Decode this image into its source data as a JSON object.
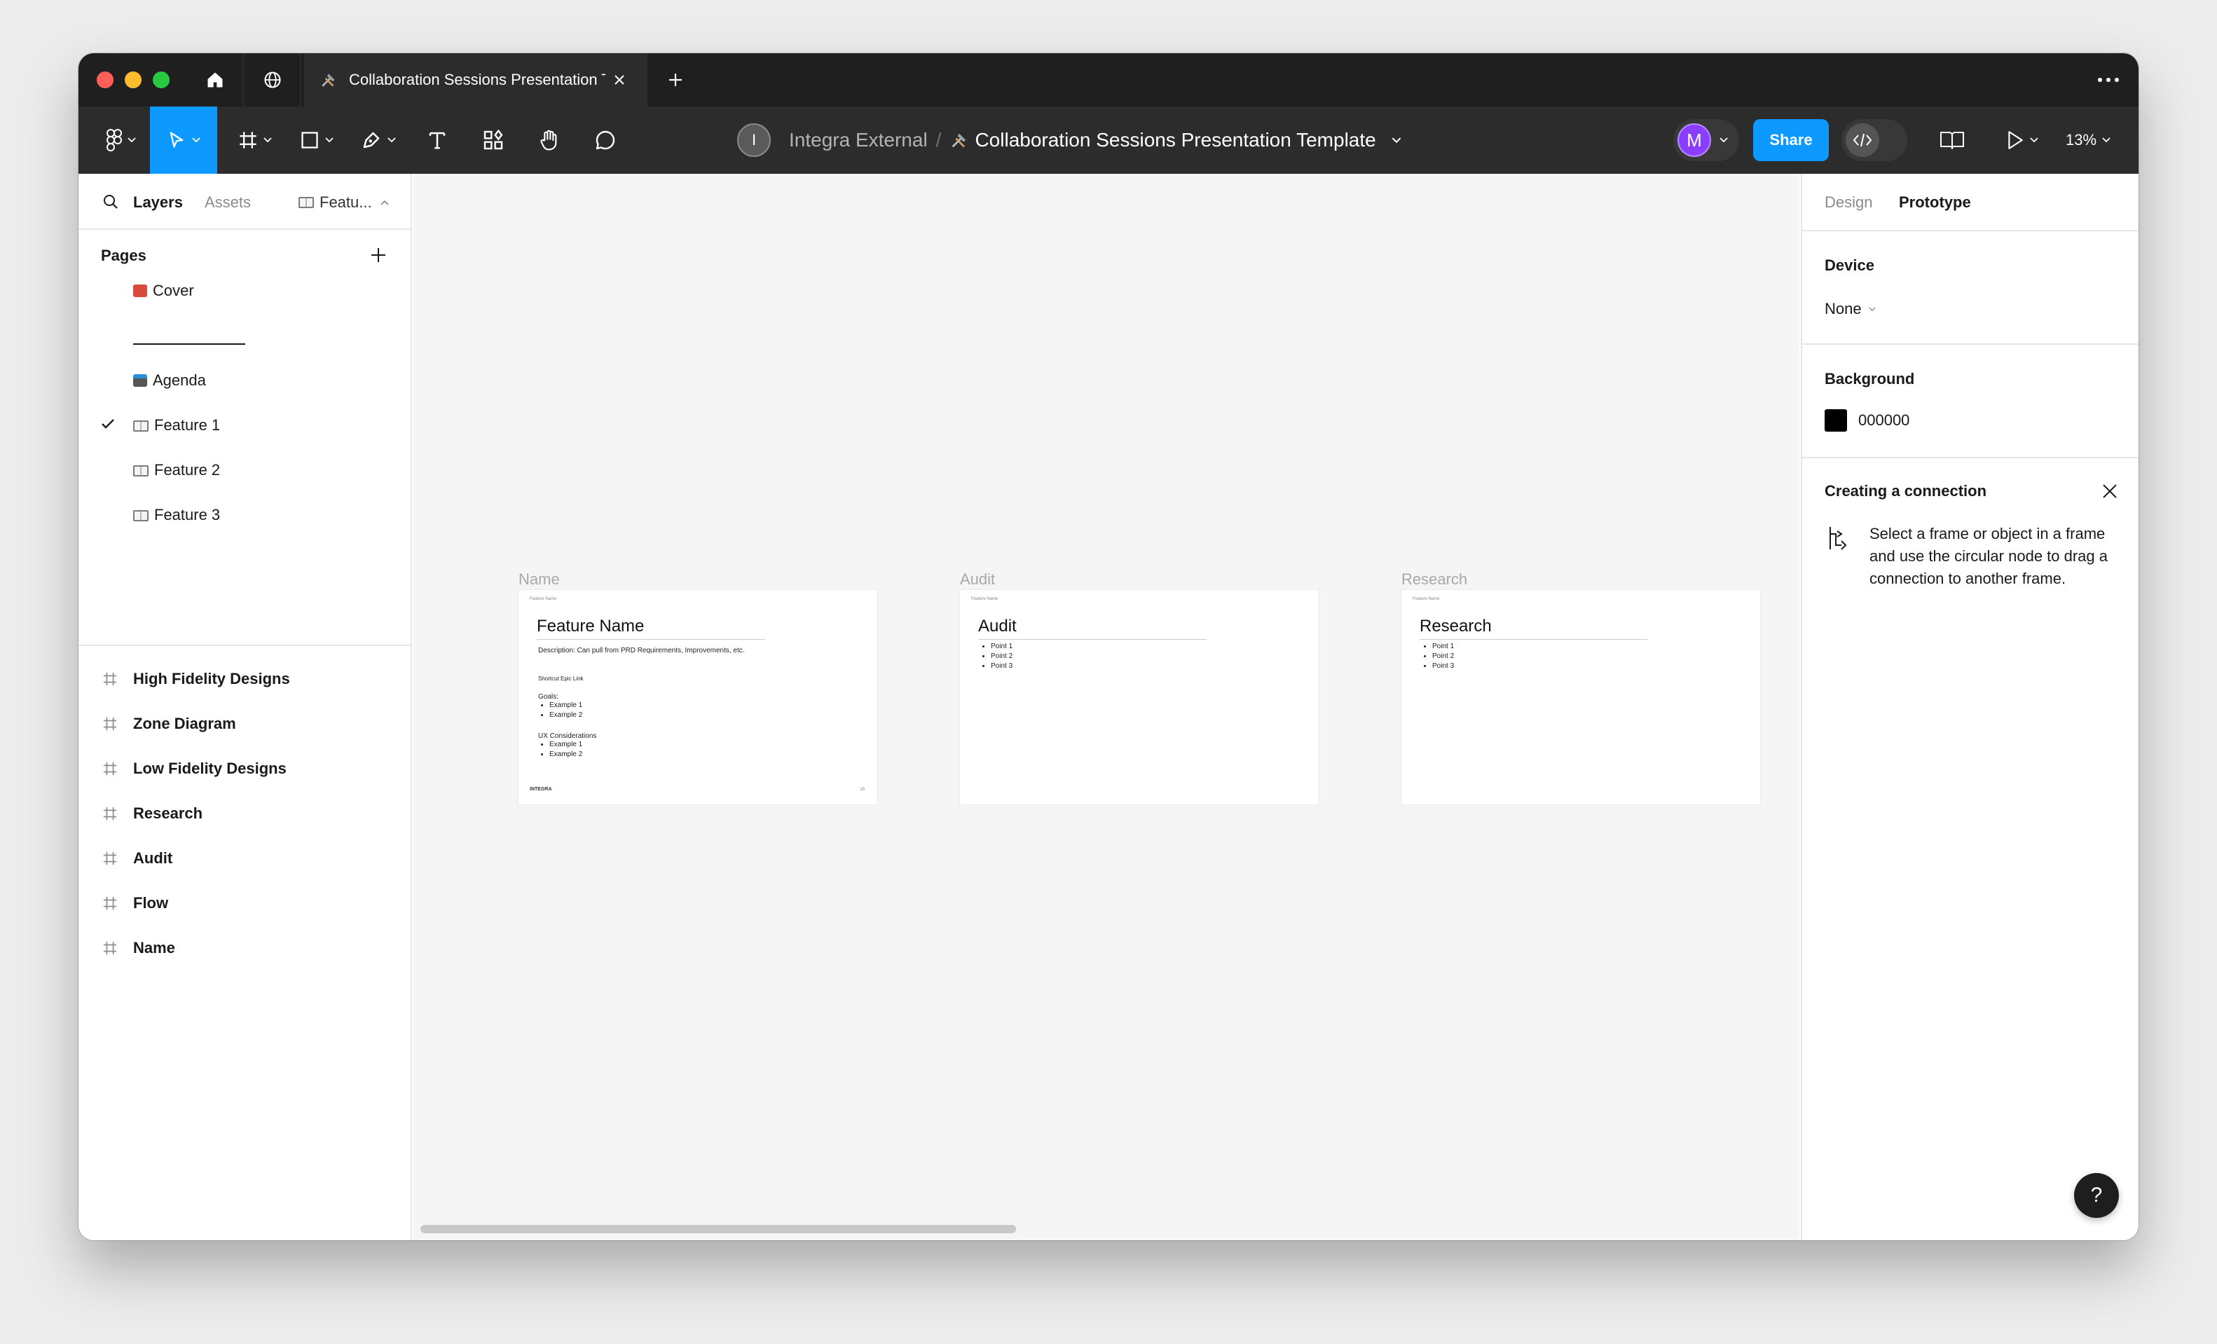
{
  "tabbar": {
    "tab_title": "Collaboration Sessions Presentation Template",
    "home_icon": "home-icon",
    "globe_icon": "globe-icon"
  },
  "toolbar": {
    "team_initial": "I",
    "team_name": "Integra External",
    "separator": "/",
    "file_name": "Collaboration Sessions Presentation Template",
    "user_initial": "M",
    "share_label": "Share",
    "zoom": "13%"
  },
  "left_panel": {
    "tab_layers": "Layers",
    "tab_assets": "Assets",
    "page_select": "Featu...",
    "pages_header": "Pages",
    "pages": [
      {
        "label": "Cover"
      },
      {
        "label": "Agenda"
      },
      {
        "label": "Feature 1"
      },
      {
        "label": "Feature 2"
      },
      {
        "label": "Feature 3"
      }
    ],
    "layers": [
      {
        "label": "High Fidelity Designs"
      },
      {
        "label": "Zone Diagram"
      },
      {
        "label": "Low Fidelity Designs"
      },
      {
        "label": "Research"
      },
      {
        "label": "Audit"
      },
      {
        "label": "Flow"
      },
      {
        "label": "Name"
      }
    ]
  },
  "canvas": {
    "frames": [
      {
        "label": "Name",
        "tiny": "Feature Name",
        "title": "Feature Name",
        "description": "Description: Can pull from PRD Requirements, Improvements, etc.",
        "epic_link": "Shortcut Epic Link",
        "goals_label": "Goals:",
        "goals": [
          "Example 1",
          "Example 2"
        ],
        "ux_label": "UX Considerations",
        "ux": [
          "Example 1",
          "Example 2"
        ],
        "footer_logo": "INTEGRA",
        "footer_num": "10"
      },
      {
        "label": "Audit",
        "tiny": "Feature Name",
        "title": "Audit",
        "points": [
          "Point 1",
          "Point 2",
          "Point 3"
        ]
      },
      {
        "label": "Research",
        "tiny": "Feature Name",
        "title": "Research",
        "points": [
          "Point 1",
          "Point 2",
          "Point 3"
        ]
      }
    ]
  },
  "right_panel": {
    "tab_design": "Design",
    "tab_prototype": "Prototype",
    "device_heading": "Device",
    "device_value": "None",
    "background_heading": "Background",
    "background_value": "000000",
    "background_color": "#000000",
    "connection_heading": "Creating a connection",
    "connection_text": "Select a frame or object in a frame and use the circular node to drag a connection to another frame."
  },
  "help": {
    "label": "?"
  },
  "colors": {
    "accent": "#0d99ff",
    "user_avatar": "#8b3dff",
    "toolbar_bg": "#2c2c2c",
    "tabbar_bg": "#1f1f1f"
  }
}
